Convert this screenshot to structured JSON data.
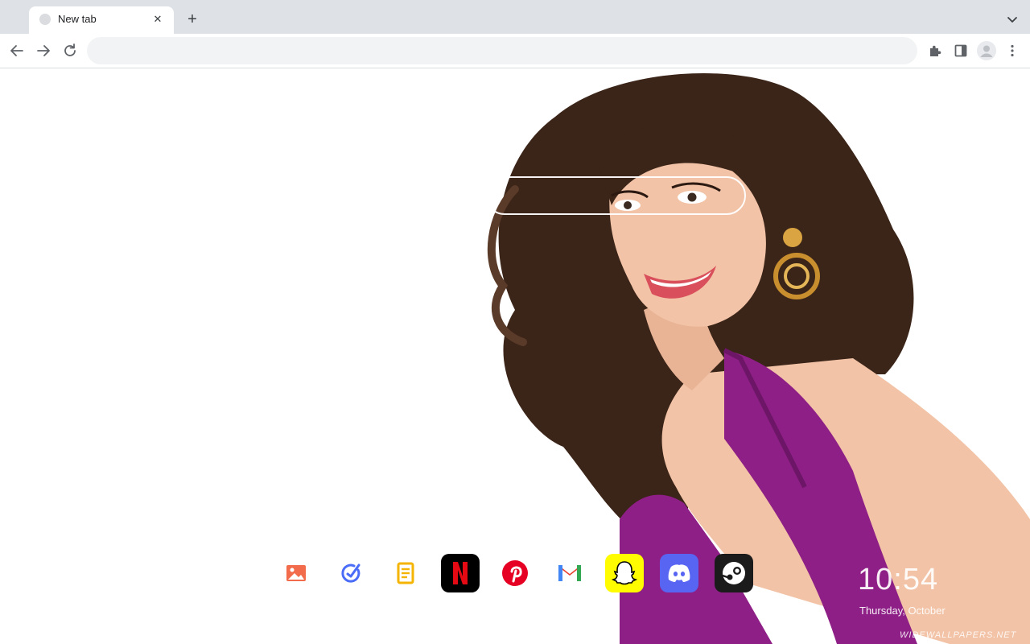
{
  "browser": {
    "tabs": [
      {
        "title": "New tab",
        "active": true
      }
    ],
    "new_tab_symbol": "+",
    "close_symbol": "✕",
    "omnibox": {
      "value": "",
      "placeholder": ""
    },
    "icons": {
      "back": "arrow-left-icon",
      "forward": "arrow-right-icon",
      "reload": "reload-icon",
      "extensions": "puzzle-icon",
      "side_panel": "side-panel-icon",
      "profile": "avatar-icon",
      "menu": "kebab-menu-icon",
      "tab_search": "chevron-down-icon"
    }
  },
  "newtab": {
    "search": {
      "placeholder": ""
    },
    "shortcuts": [
      {
        "name": "photos",
        "icon": "image-icon",
        "color": "#f26b4b"
      },
      {
        "name": "tasks",
        "icon": "check-circle-icon",
        "color": "#4a6cf7"
      },
      {
        "name": "notes",
        "icon": "notes-icon",
        "color": "#f4b400"
      },
      {
        "name": "netflix",
        "icon": "netflix-icon",
        "color": "#e50914"
      },
      {
        "name": "pinterest",
        "icon": "pinterest-icon",
        "color": "#e60023"
      },
      {
        "name": "gmail",
        "icon": "gmail-icon",
        "color": "#ea4335"
      },
      {
        "name": "snapchat",
        "icon": "snapchat-icon",
        "color": "#fffc00"
      },
      {
        "name": "discord",
        "icon": "discord-icon",
        "color": "#5865f2"
      },
      {
        "name": "steam",
        "icon": "steam-icon",
        "color": "#1b1b1b"
      }
    ],
    "clock": "10:54",
    "date": "Thursday, October",
    "watermark": "WIDEWALLPAPERS.NET"
  },
  "theme": {
    "tabstrip_bg": "#dee1e6",
    "toolbar_bg": "#ffffff",
    "omnibox_bg": "#f1f3f4",
    "dress_color": "#8e1f86",
    "hair_color": "#3b2418",
    "skin_color": "#f2c3a6"
  }
}
